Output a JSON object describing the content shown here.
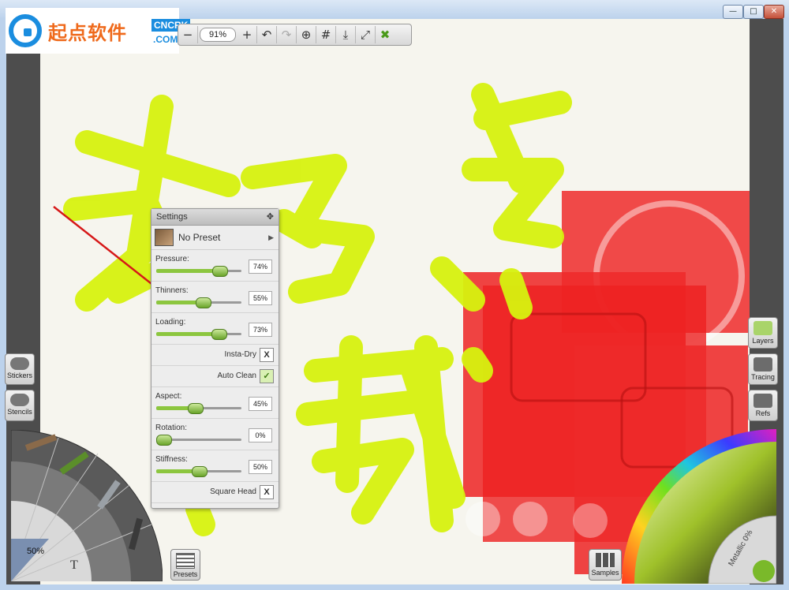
{
  "watermark": {
    "brand": "起点软件",
    "domain_badge": "CNCRK",
    "domain_suffix": ".COM"
  },
  "window": {
    "buttons": [
      "—",
      "□",
      "✕"
    ]
  },
  "toolbar": {
    "zoom": "91%",
    "zoom_minus": "−",
    "zoom_plus": "+"
  },
  "left_sidebar": {
    "stickers": "Stickers",
    "stencils": "Stencils"
  },
  "right_sidebar": {
    "layers": "Layers",
    "tracing": "Tracing",
    "refs": "Refs"
  },
  "settings_panel": {
    "title": "Settings",
    "preset": "No Preset",
    "sliders": [
      {
        "label": "Pressure:",
        "value": "74%",
        "level": 0.74
      },
      {
        "label": "Thinners:",
        "value": "55%",
        "level": 0.55
      },
      {
        "label": "Loading:",
        "value": "73%",
        "level": 0.73
      },
      {
        "label": "Aspect:",
        "value": "45%",
        "level": 0.45
      },
      {
        "label": "Rotation:",
        "value": "0%",
        "level": 0.0
      },
      {
        "label": "Stiffness:",
        "value": "50%",
        "level": 0.5
      }
    ],
    "toggles": {
      "insta_dry": {
        "label": "Insta-Dry",
        "mark": "X"
      },
      "auto_clean": {
        "label": "Auto Clean",
        "mark": "✓"
      },
      "square_head": {
        "label": "Square Head",
        "mark": "X"
      }
    }
  },
  "bottom": {
    "presets": "Presets",
    "samples": "Samples",
    "tool_size": "50%",
    "metallic": "Metallic 0%"
  },
  "colors": {
    "paint": "#d7f20f",
    "red": "#ee2a2a",
    "accent_green": "#8cc63f"
  }
}
